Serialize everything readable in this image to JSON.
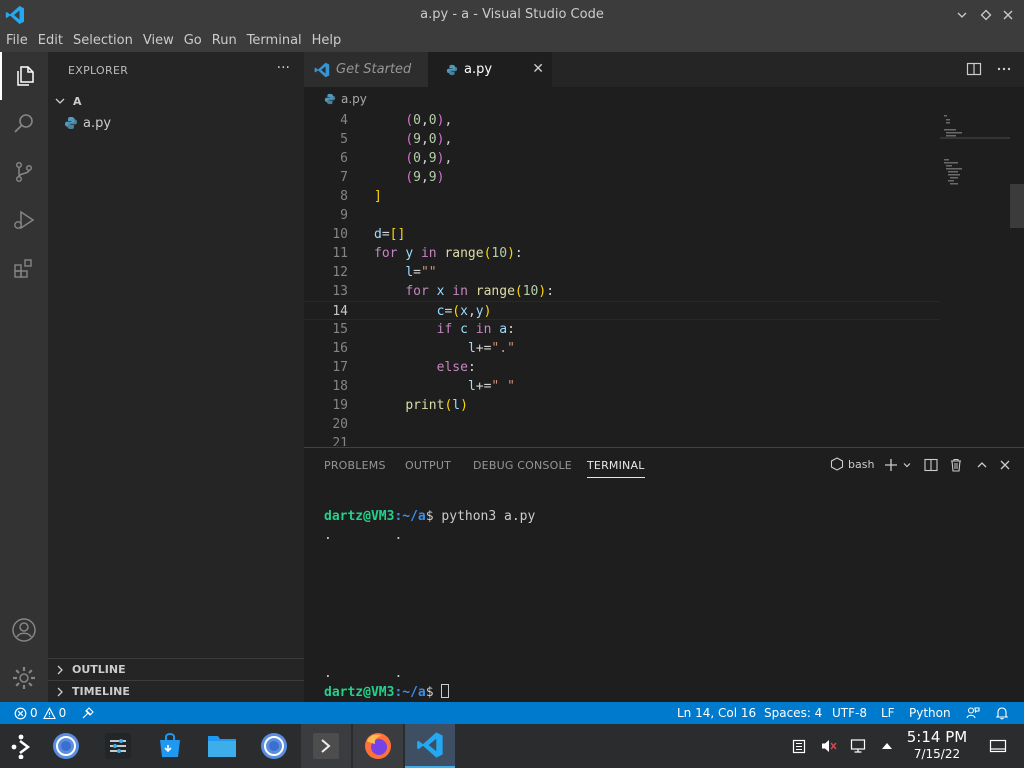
{
  "window": {
    "title": "a.py - a - Visual Studio Code"
  },
  "menu": [
    "File",
    "Edit",
    "Selection",
    "View",
    "Go",
    "Run",
    "Terminal",
    "Help"
  ],
  "sidebar": {
    "header": "EXPLORER",
    "more": "···",
    "folder": "A",
    "file": "a.py",
    "outline": "OUTLINE",
    "timeline": "TIMELINE"
  },
  "tabs": {
    "get_started": "Get Started",
    "active": "a.py",
    "close": "✕"
  },
  "breadcrumb": {
    "file": "a.py"
  },
  "editor": {
    "lines": [
      {
        "n": "4",
        "code": "    (0,0),"
      },
      {
        "n": "5",
        "code": "    (9,0),"
      },
      {
        "n": "6",
        "code": "    (0,9),"
      },
      {
        "n": "7",
        "code": "    (9,9)"
      },
      {
        "n": "8",
        "code": "]"
      },
      {
        "n": "9",
        "code": ""
      },
      {
        "n": "10",
        "code": "d=[]"
      },
      {
        "n": "11",
        "code": "for y in range(10):"
      },
      {
        "n": "12",
        "code": "    l=\"\""
      },
      {
        "n": "13",
        "code": "    for x in range(10):"
      },
      {
        "n": "14",
        "code": "        c=(x,y)"
      },
      {
        "n": "15",
        "code": "        if c in a:"
      },
      {
        "n": "16",
        "code": "            l+=\".\""
      },
      {
        "n": "17",
        "code": "        else:"
      },
      {
        "n": "18",
        "code": "            l+=\" \""
      },
      {
        "n": "19",
        "code": "    print(l)"
      },
      {
        "n": "20",
        "code": ""
      },
      {
        "n": "21",
        "code": ""
      }
    ]
  },
  "panel": {
    "tabs": [
      "PROBLEMS",
      "OUTPUT",
      "DEBUG CONSOLE",
      "TERMINAL"
    ],
    "shell": "bash",
    "terminal": {
      "user_host": "dartz@VM3",
      "path": ":~/a",
      "dollar": "$",
      "command": " python3 a.py",
      "out_first": ".        .",
      "out_last": ".        ."
    }
  },
  "status": {
    "errors": "0",
    "warnings": "0",
    "position": "Ln 14, Col 16",
    "spaces": "Spaces: 4",
    "encoding": "UTF-8",
    "eol": "LF",
    "language": "Python"
  },
  "taskbar": {
    "time": "5:14 PM",
    "date": "7/15/22"
  },
  "colors": {
    "accent": "#007acc",
    "keyword": "#c586c0",
    "function": "#dcdcaa",
    "string": "#ce9178",
    "number": "#b5cea8",
    "bracket_gold": "#ffd700",
    "bracket_purple": "#da70d6",
    "bracket_blue": "#179fff",
    "prompt_green": "#23d18b",
    "prompt_blue": "#3b8eea"
  }
}
